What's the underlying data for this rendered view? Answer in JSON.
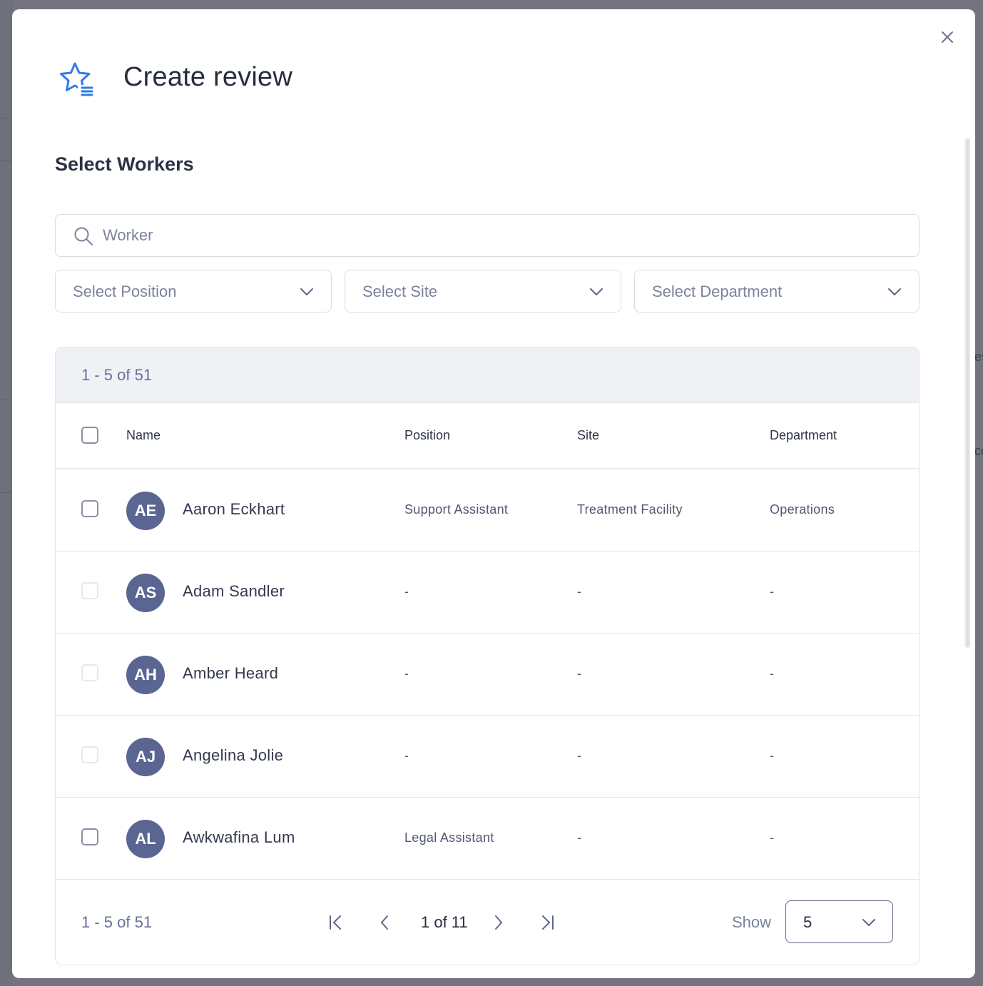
{
  "modal": {
    "title": "Create review",
    "section_title": "Select Workers"
  },
  "search": {
    "placeholder": "Worker"
  },
  "filters": {
    "position": "Select Position",
    "site": "Select Site",
    "department": "Select Department"
  },
  "table": {
    "count_text": "1 - 5 of 51",
    "columns": {
      "name": "Name",
      "position": "Position",
      "site": "Site",
      "department": "Department"
    },
    "rows": [
      {
        "initials": "AE",
        "name": "Aaron Eckhart",
        "position": "Support Assistant",
        "site": "Treatment Facility",
        "department": "Operations"
      },
      {
        "initials": "AS",
        "name": "Adam Sandler",
        "position": "-",
        "site": "-",
        "department": "-"
      },
      {
        "initials": "AH",
        "name": "Amber Heard",
        "position": "-",
        "site": "-",
        "department": "-"
      },
      {
        "initials": "AJ",
        "name": "Angelina Jolie",
        "position": "-",
        "site": "-",
        "department": "-"
      },
      {
        "initials": "AL",
        "name": "Awkwafina Lum",
        "position": "Legal Assistant",
        "site": "-",
        "department": "-"
      }
    ]
  },
  "pagination": {
    "count_text": "1 - 5 of 51",
    "page_text": "1 of 11",
    "show_label": "Show",
    "page_size": "5"
  },
  "backdrop": {
    "text_1": "es",
    "text_2": "co"
  },
  "colors": {
    "accent": "#2f7be8",
    "avatar": "#5b6592"
  },
  "icons": {
    "header": "star-list-icon",
    "close": "close-icon",
    "search": "search-icon",
    "dropdown": "chevron-down-icon"
  }
}
